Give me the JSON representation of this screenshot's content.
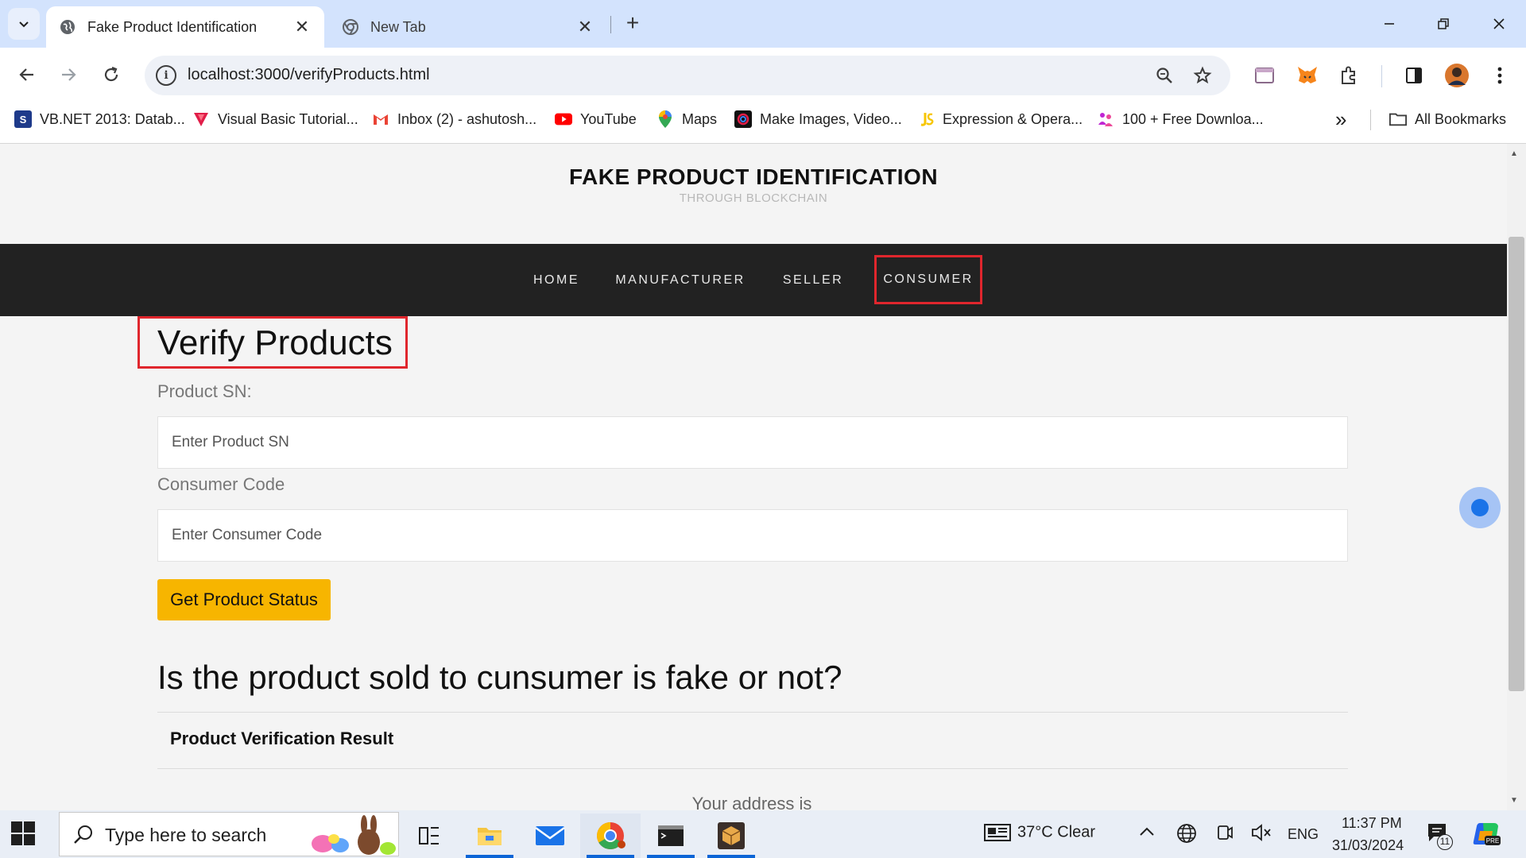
{
  "browser": {
    "tabs": [
      {
        "title": "Fake Product Identification",
        "active": true,
        "icon": "globe-icon"
      },
      {
        "title": "New Tab",
        "active": false,
        "icon": "chrome-icon"
      }
    ],
    "close_glyph": "✕",
    "new_tab_glyph": "+",
    "url": "localhost:3000/verifyProducts.html",
    "bookmarks": [
      {
        "label": "VB.NET 2013: Datab...",
        "icon": "vb-icon",
        "color": "#1e3a8a"
      },
      {
        "label": "Visual Basic Tutorial...",
        "icon": "v-logo-icon",
        "color": "#e11d48"
      },
      {
        "label": "Inbox (2) - ashutosh...",
        "icon": "gmail-icon",
        "color": "#ea4335"
      },
      {
        "label": "YouTube",
        "icon": "youtube-icon",
        "color": "#ff0000"
      },
      {
        "label": "Maps",
        "icon": "maps-icon",
        "color": "#34a853"
      },
      {
        "label": "Make Images, Video...",
        "icon": "canva-icon",
        "color": "#111111"
      },
      {
        "label": "Expression & Opera...",
        "icon": "js-icon",
        "color": "#f7c600"
      },
      {
        "label": "100 + Free Downloa...",
        "icon": "people-icon",
        "color": "#c026d3"
      }
    ],
    "more_bookmarks_glyph": "»",
    "all_bookmarks_label": "All Bookmarks"
  },
  "site": {
    "title": "FAKE PRODUCT IDENTIFICATION",
    "subtitle": "THROUGH BLOCKCHAIN",
    "nav": [
      "HOME",
      "MANUFACTURER",
      "SELLER",
      "CONSUMER"
    ],
    "highlighted_nav": "CONSUMER",
    "accent_color": "#f7b500",
    "highlight_color": "#e0262d"
  },
  "form": {
    "heading": "Verify Products",
    "product_sn_label": "Product SN:",
    "product_sn_placeholder": "Enter Product SN",
    "consumer_code_label": "Consumer Code",
    "consumer_code_placeholder": "Enter Consumer Code",
    "submit_label": "Get Product Status"
  },
  "result": {
    "question": "Is the product sold to cunsumer is fake or not?",
    "heading": "Product Verification Result",
    "address_text": "Your address is"
  },
  "taskbar": {
    "search_placeholder": "Type here to search",
    "weather": "37°C  Clear",
    "language": "ENG",
    "time": "11:37 PM",
    "date": "31/03/2024",
    "notification_count": "11"
  }
}
